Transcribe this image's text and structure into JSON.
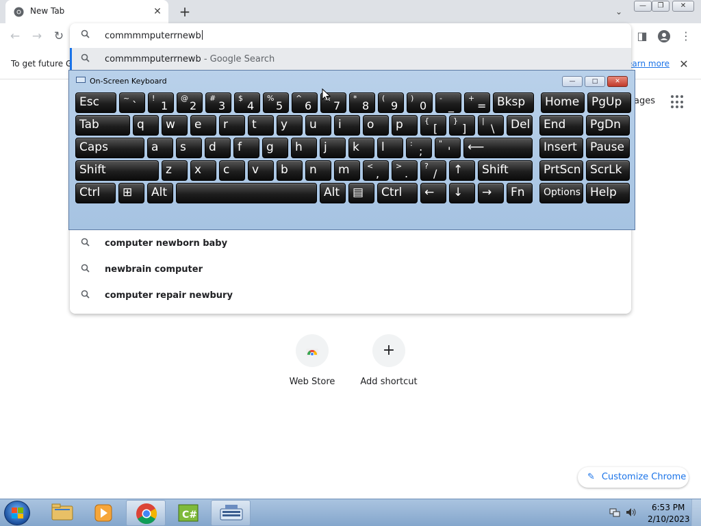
{
  "browser": {
    "tab": {
      "title": "New Tab",
      "favicon": "chrome-icon",
      "close_icon": "✕"
    },
    "new_tab_icon": "+",
    "tab_search_icon": "⌄",
    "window_controls": {
      "minimize": "—",
      "maximize": "❐",
      "close": "✕"
    },
    "nav": {
      "back": "←",
      "forward": "→",
      "reload": "↻"
    },
    "toolbar_icons": {
      "side_panel": "◨",
      "profile": "person-icon",
      "menu": "⋮"
    }
  },
  "infobar": {
    "text": "To get future G",
    "link": "earn more",
    "close": "✕"
  },
  "omnibox": {
    "input_value": "commmmputerrnewb",
    "selected_suggestion": {
      "text": "commmmputerrnewb",
      "suffix": " - Google Search"
    },
    "suggestions": [
      "computer newborn baby",
      "newbrain computer",
      "computer repair newbury"
    ],
    "search_icon": "⚲"
  },
  "ntp": {
    "images_link": "ages",
    "shortcuts": [
      {
        "label": "Web Store",
        "icon": "chrome-web-store-icon"
      },
      {
        "label": "Add shortcut",
        "icon": "+"
      }
    ],
    "customize_label": "Customize Chrome",
    "customize_icon": "✎"
  },
  "osk": {
    "title": "On-Screen Keyboard",
    "controls": {
      "minimize": "—",
      "restore": "□",
      "close": "✕"
    },
    "rows": [
      [
        {
          "main": "Esc"
        },
        {
          "shift": "~",
          "lower": "`"
        },
        {
          "shift": "!",
          "lower": "1"
        },
        {
          "shift": "@",
          "lower": "2"
        },
        {
          "shift": "#",
          "lower": "3"
        },
        {
          "shift": "$",
          "lower": "4"
        },
        {
          "shift": "%",
          "lower": "5"
        },
        {
          "shift": "^",
          "lower": "6"
        },
        {
          "shift": "&",
          "lower": "7"
        },
        {
          "shift": "*",
          "lower": "8"
        },
        {
          "shift": "(",
          "lower": "9"
        },
        {
          "shift": ")",
          "lower": "0"
        },
        {
          "shift": "-",
          "lower": "_"
        },
        {
          "shift": "+",
          "lower": "="
        },
        {
          "main": "Bksp"
        },
        {
          "main": "Home"
        },
        {
          "main": "PgUp"
        }
      ],
      [
        {
          "main": "Tab"
        },
        {
          "main": "q"
        },
        {
          "main": "w"
        },
        {
          "main": "e"
        },
        {
          "main": "r"
        },
        {
          "main": "t"
        },
        {
          "main": "y"
        },
        {
          "main": "u"
        },
        {
          "main": "i"
        },
        {
          "main": "o"
        },
        {
          "main": "p"
        },
        {
          "shift": "{",
          "lower": "["
        },
        {
          "shift": "}",
          "lower": "]"
        },
        {
          "shift": "|",
          "lower": "\\"
        },
        {
          "main": "Del"
        },
        {
          "main": "End"
        },
        {
          "main": "PgDn"
        }
      ],
      [
        {
          "main": "Caps"
        },
        {
          "main": "a"
        },
        {
          "main": "s"
        },
        {
          "main": "d"
        },
        {
          "main": "f"
        },
        {
          "main": "g"
        },
        {
          "main": "h"
        },
        {
          "main": "j"
        },
        {
          "main": "k"
        },
        {
          "main": "l"
        },
        {
          "shift": ":",
          "lower": ";"
        },
        {
          "shift": "\"",
          "lower": "'"
        },
        {
          "main": "⟵"
        },
        {
          "main": "Insert"
        },
        {
          "main": "Pause"
        }
      ],
      [
        {
          "main": "Shift"
        },
        {
          "main": "z"
        },
        {
          "main": "x"
        },
        {
          "main": "c"
        },
        {
          "main": "v"
        },
        {
          "main": "b"
        },
        {
          "main": "n"
        },
        {
          "main": "m"
        },
        {
          "shift": "<",
          "lower": ","
        },
        {
          "shift": ">",
          "lower": "."
        },
        {
          "shift": "?",
          "lower": "/"
        },
        {
          "main": "↑"
        },
        {
          "main": "Shift"
        },
        {
          "main": "PrtScn"
        },
        {
          "main": "ScrLk"
        }
      ],
      [
        {
          "main": "Ctrl"
        },
        {
          "main": "⊞"
        },
        {
          "main": "Alt"
        },
        {
          "main": ""
        },
        {
          "main": "Alt"
        },
        {
          "main": "▤"
        },
        {
          "main": "Ctrl"
        },
        {
          "main": "←"
        },
        {
          "main": "↓"
        },
        {
          "main": "→"
        },
        {
          "main": "Fn"
        },
        {
          "main": "Options"
        },
        {
          "main": "Help"
        }
      ]
    ]
  },
  "taskbar": {
    "apps": [
      "explorer-icon",
      "media-player-icon",
      "chrome-icon",
      "csharp-icon",
      "on-screen-keyboard-icon"
    ],
    "time": "6:53 PM",
    "date": "2/10/2023"
  },
  "colors": {
    "accent": "#1a73e8",
    "osk_bg": "#b9d1ea",
    "key_bg": "#1e1e1e",
    "taskbar": "#aac4e0"
  }
}
